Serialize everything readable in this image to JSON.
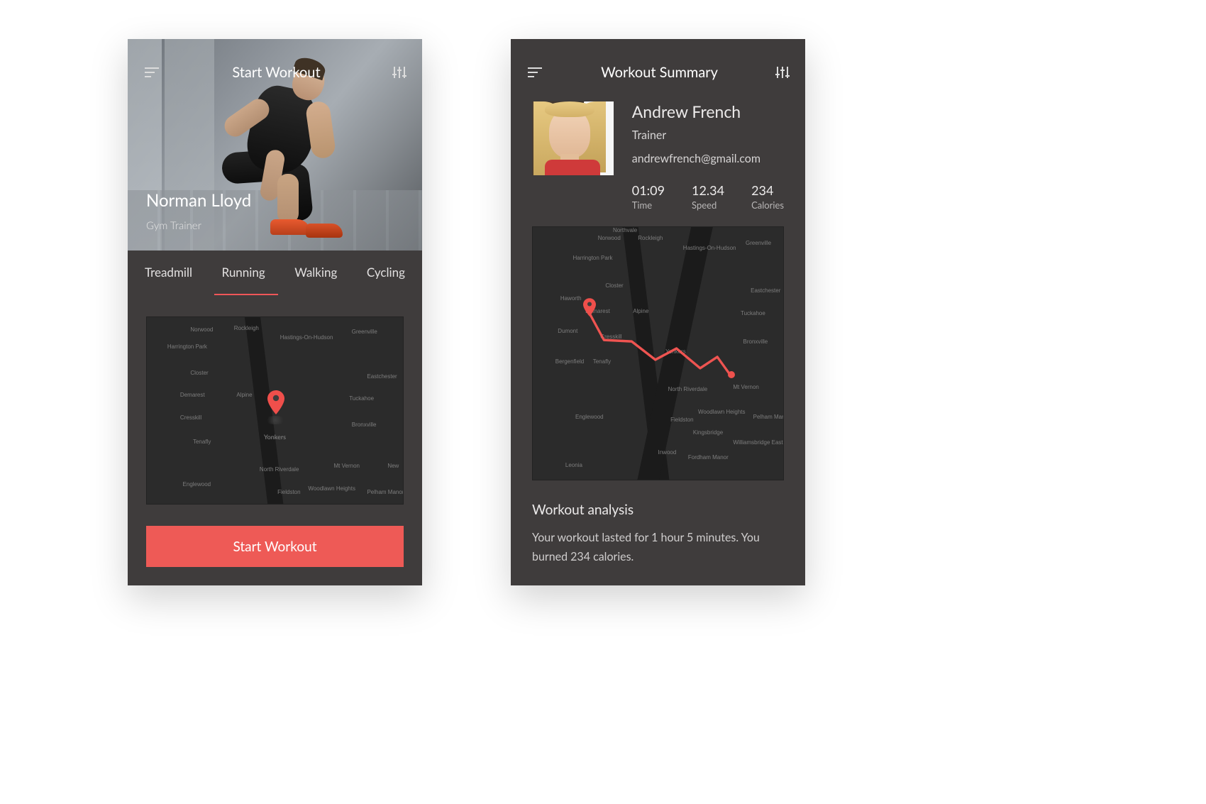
{
  "left": {
    "header": {
      "title": "Start Workout"
    },
    "hero": {
      "name": "Norman Lloyd",
      "role": "Gym Trainer"
    },
    "tabs": [
      "Treadmill",
      "Running",
      "Walking",
      "Cycling"
    ],
    "active_tab_index": 1,
    "map": {
      "center_label": "Yonkers",
      "labels": [
        "Norwood",
        "Rockleigh",
        "Harrington Park",
        "Closter",
        "Demarest",
        "Alpine",
        "Cresskill",
        "Tenafly",
        "Englewood",
        "Hastings-On-Hudson",
        "Greenville",
        "Tuckahoe",
        "Eastchester",
        "Bronxville",
        "Mt Vernon",
        "Pelham Manor",
        "North Riverdale",
        "Fieldston",
        "Woodlawn Heights",
        "New"
      ]
    },
    "cta": "Start Workout"
  },
  "right": {
    "header": {
      "title": "Workout Summary"
    },
    "profile": {
      "name": "Andrew French",
      "role": "Trainer",
      "email": "andrewfrench@gmail.com",
      "stats": [
        {
          "value": "01:09",
          "label": "Time"
        },
        {
          "value": "12.34",
          "label": "Speed"
        },
        {
          "value": "234",
          "label": "Calories"
        }
      ]
    },
    "map": {
      "labels": [
        "Norwood",
        "Rockleigh",
        "Northvale",
        "Harrington Park",
        "Closter",
        "Demarest",
        "Haworth",
        "Alpine",
        "Dumont",
        "Cresskill",
        "Bergenfield",
        "Tenafly",
        "Englewood",
        "Leonia",
        "Hastings-On-Hudson",
        "Greenville",
        "Tuckahoe",
        "Eastchester",
        "Bronxville",
        "Mt Vernon",
        "Pelham Manor",
        "Yonkers",
        "North Riverdale",
        "Fieldston",
        "Inwood",
        "Woodlawn Heights",
        "Fordham Manor",
        "Williamsbridge East Bronx",
        "Kingsbridge"
      ]
    },
    "analysis": {
      "title": "Workout analysis",
      "body": "Your workout lasted for 1 hour 5 minutes. You burned 234 calories."
    }
  },
  "colors": {
    "accent": "#ee5a56",
    "bg": "#3f3c3c"
  }
}
